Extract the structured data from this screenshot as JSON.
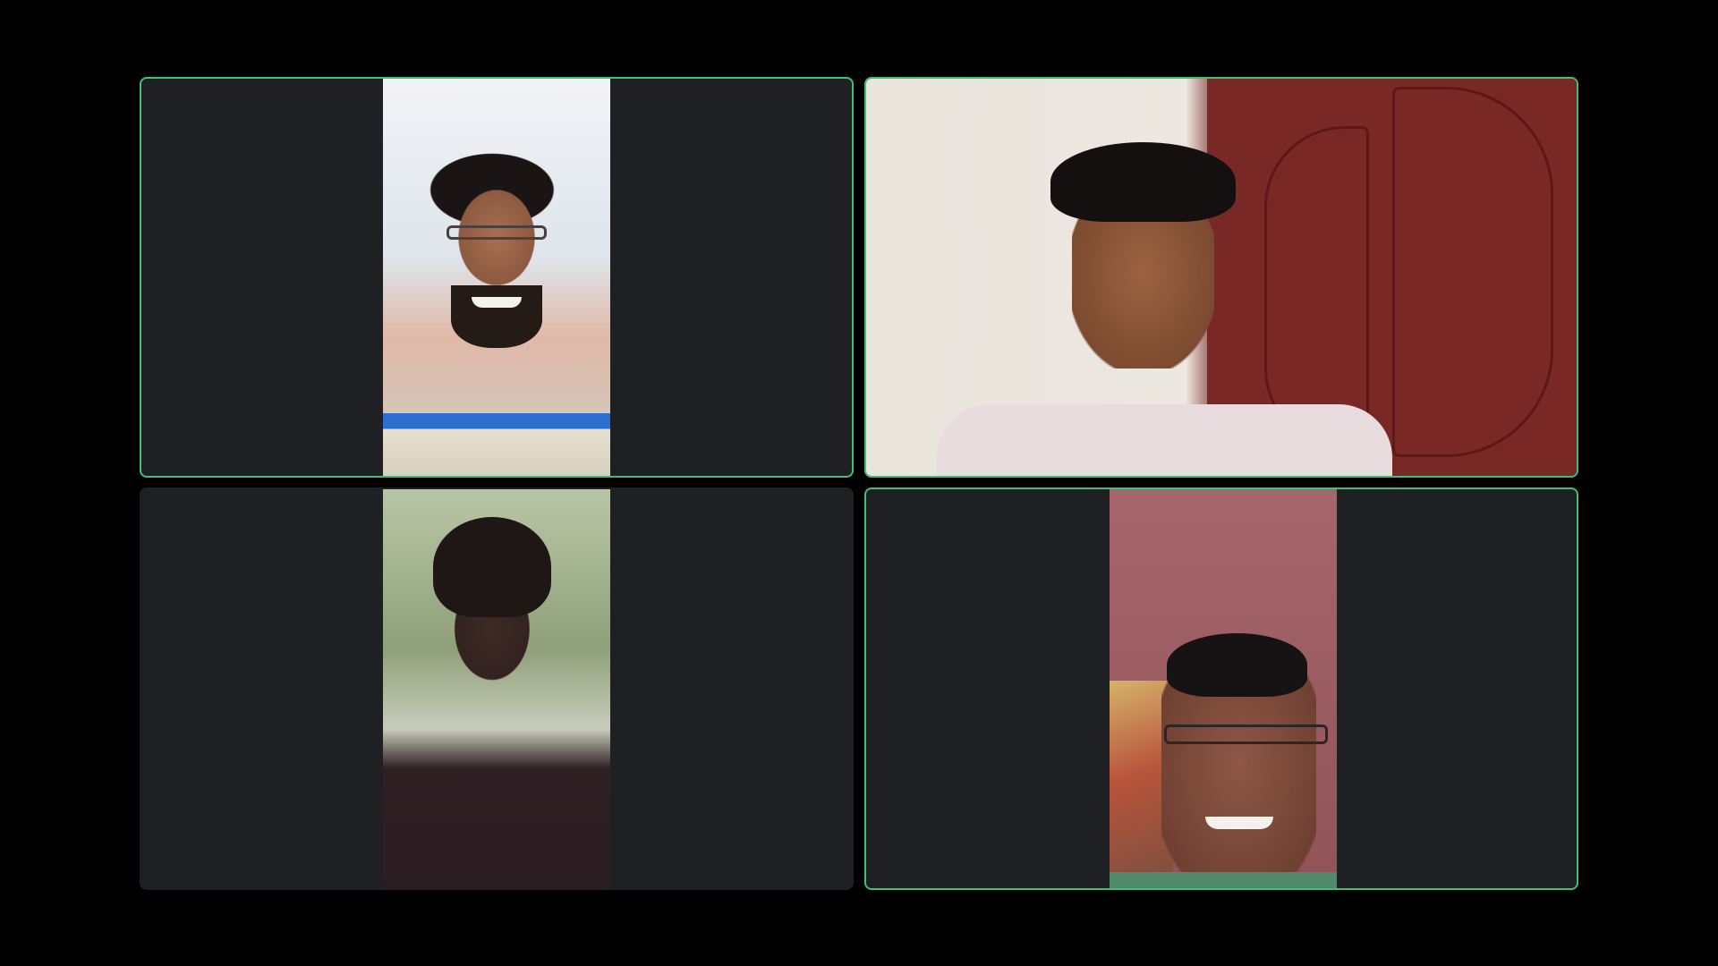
{
  "meeting": {
    "view": "gallery",
    "active_speaker_color": "#3fbf78",
    "tile_background": "#1f2024",
    "stage_background": "#000000"
  },
  "participants": [
    {
      "id": 1,
      "speaking": true,
      "video_on": true
    },
    {
      "id": 2,
      "speaking": true,
      "video_on": true
    },
    {
      "id": 3,
      "speaking": false,
      "video_on": true
    },
    {
      "id": 4,
      "speaking": true,
      "video_on": true
    }
  ]
}
